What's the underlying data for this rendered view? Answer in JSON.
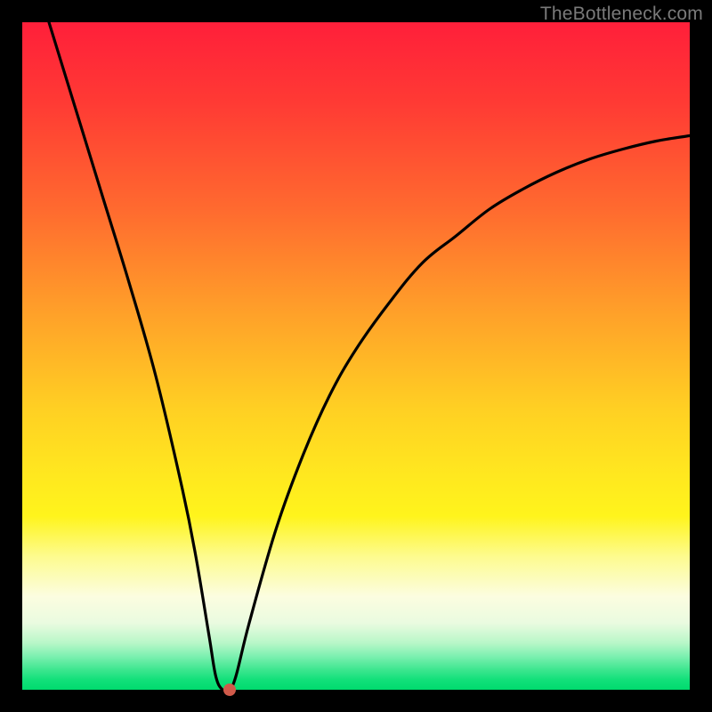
{
  "watermark": "TheBottleneck.com",
  "colors": {
    "frame": "#000000",
    "curve": "#000000",
    "dot": "#d05a4a",
    "gradient_top": "#ff1f3a",
    "gradient_bottom": "#00db6e"
  },
  "chart_data": {
    "type": "line",
    "title": "",
    "xlabel": "",
    "ylabel": "",
    "xlim": [
      0,
      100
    ],
    "ylim": [
      0,
      100
    ],
    "grid": false,
    "legend": false,
    "series": [
      {
        "name": "bottleneck-curve",
        "x": [
          4,
          8,
          12,
          16,
          20,
          24,
          26,
          28,
          29,
          30,
          31,
          32,
          34,
          38,
          42,
          46,
          50,
          55,
          60,
          65,
          70,
          75,
          80,
          85,
          90,
          95,
          100
        ],
        "y": [
          100,
          87,
          74,
          61,
          47,
          30,
          20,
          8,
          2,
          0,
          0,
          2,
          10,
          24,
          35,
          44,
          51,
          58,
          64,
          68,
          72,
          75,
          77.5,
          79.5,
          81,
          82.2,
          83
        ]
      }
    ],
    "annotations": [
      {
        "name": "optimal-point",
        "x": 31,
        "y": 0
      }
    ],
    "background": "vertical-gradient red→green (bottleneck severity scale)"
  }
}
